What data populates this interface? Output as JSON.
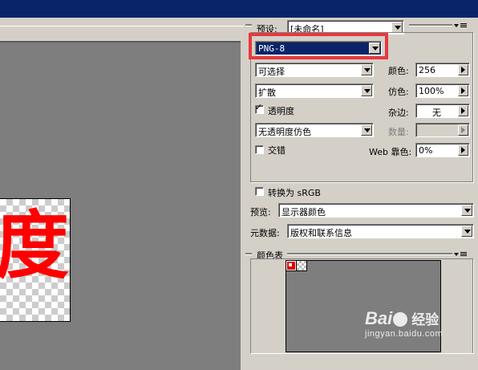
{
  "settings": {
    "preset_label": "预设:",
    "preset_value": "[未命名]",
    "format_value": "PNG-8",
    "reduction_value": "可选择",
    "dither_value": "扩散",
    "colors_label": "颜色:",
    "colors_value": "256",
    "dither_amount_label": "仿色:",
    "dither_amount_value": "100%",
    "transparency_label": "透明度",
    "transparency_checked": true,
    "matte_label": "杂边:",
    "matte_value": "无",
    "transparency_dither_value": "无透明度仿色",
    "amount_label": "数量:",
    "interlaced_label": "交错",
    "web_snap_label": "Web 靠色:",
    "web_snap_value": "0%",
    "convert_srgb_label": "转换为 sRGB",
    "preview_label": "预览:",
    "preview_value": "显示器颜色",
    "metadata_label": "元数据:",
    "metadata_value": "版权和联系信息"
  },
  "color_table": {
    "title": "颜色表",
    "swatch_colors": [
      "#e00000",
      "#ffffff"
    ]
  },
  "canvas": {
    "glyph": "度",
    "glyph_color": "#ff0000"
  },
  "watermark": {
    "logo": "Bai",
    "logo_suffix": "经验",
    "url": "jingyan.baidu.com"
  },
  "colors": {
    "titlebar": "#0a246a",
    "panel": "#d4d0c8",
    "canvas_bg": "#7e7e7e",
    "highlight": "#e8383d"
  }
}
